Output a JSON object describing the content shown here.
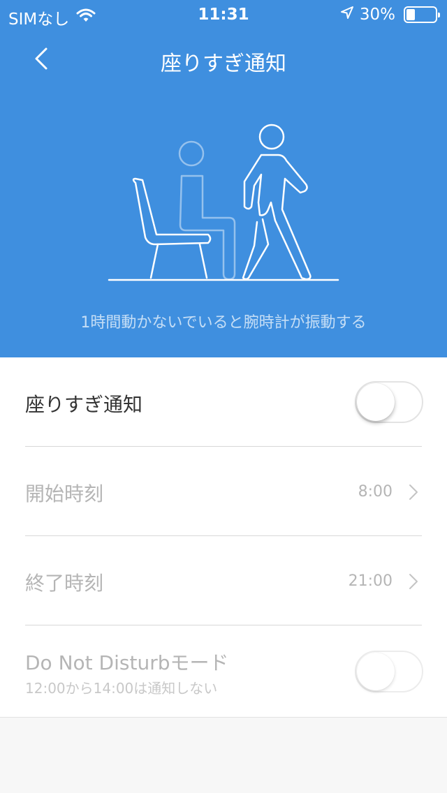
{
  "status_bar": {
    "carrier": "SIMなし",
    "time": "11:31",
    "battery_percent": "30%",
    "battery_level": 0.3,
    "icons": [
      "wifi-icon",
      "location-arrow-icon",
      "battery-icon"
    ]
  },
  "nav": {
    "title": "座りすぎ通知",
    "back_icon": "chevron-left-icon"
  },
  "hero": {
    "caption": "1時間動かないでいると腕時計が振動する",
    "illustration": "sitting-and-walking-person-illustration",
    "background_color": "#3f8fdf"
  },
  "settings": {
    "sedentary": {
      "label": "座りすぎ通知",
      "enabled": false
    },
    "start_time": {
      "label": "開始時刻",
      "value": "8:00"
    },
    "end_time": {
      "label": "終了時刻",
      "value": "21:00"
    },
    "dnd": {
      "label": "Do Not Disturbモード",
      "sublabel": "12:00から14:00は通知しない",
      "enabled": false
    }
  }
}
